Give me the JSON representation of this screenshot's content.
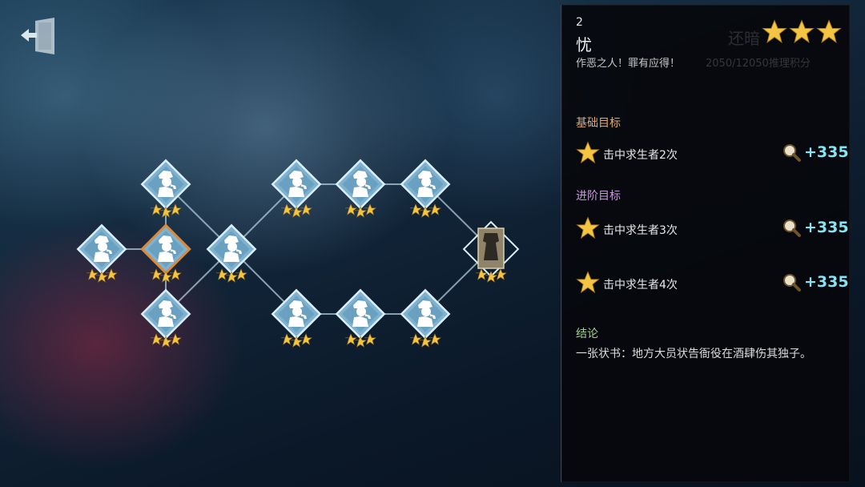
{
  "panel": {
    "level_number": "2",
    "title": "忧",
    "subtitle": "作恶之人！罪有应得！",
    "ghost_title": "还暗",
    "ghost_subtitle": "2050/12050推理积分",
    "title_star_count": 3,
    "basic_heading": "基础目标",
    "advanced_heading": "进阶目标",
    "conclusion_heading": "结论",
    "conclusion_text": "一张状书：地方大员状告衙役在酒肆伤其独子。",
    "basic_tasks": [
      {
        "label": "击中求生者2次",
        "reward": "+335"
      }
    ],
    "advanced_tasks": [
      {
        "label": "击中求生者3次",
        "reward": "+335"
      },
      {
        "label": "击中求生者4次",
        "reward": "+335"
      }
    ]
  },
  "map": {
    "nodes": [
      {
        "id": "n1",
        "stars": 3,
        "selected": false,
        "type": "detective"
      },
      {
        "id": "n2-top",
        "stars": 3,
        "selected": false,
        "type": "detective"
      },
      {
        "id": "n2-mid",
        "stars": 3,
        "selected": true,
        "type": "detective"
      },
      {
        "id": "n2-bot",
        "stars": 3,
        "selected": false,
        "type": "detective"
      },
      {
        "id": "n3",
        "stars": 3,
        "selected": false,
        "type": "detective"
      },
      {
        "id": "n4-top",
        "stars": 3,
        "selected": false,
        "type": "detective"
      },
      {
        "id": "n5-top",
        "stars": 3,
        "selected": false,
        "type": "detective"
      },
      {
        "id": "n6-top",
        "stars": 3,
        "selected": false,
        "type": "detective"
      },
      {
        "id": "n4-bot",
        "stars": 3,
        "selected": false,
        "type": "detective"
      },
      {
        "id": "n5-bot",
        "stars": 3,
        "selected": false,
        "type": "detective"
      },
      {
        "id": "n6-bot",
        "stars": 3,
        "selected": false,
        "type": "detective"
      },
      {
        "id": "n-final",
        "stars": 3,
        "selected": false,
        "type": "portrait"
      }
    ]
  },
  "colors": {
    "node_fill": "#7fb2cf",
    "node_border": "#d9eef8",
    "selected_border": "#d88a3a",
    "star": "#f3c542",
    "reward": "#86e3f2"
  }
}
